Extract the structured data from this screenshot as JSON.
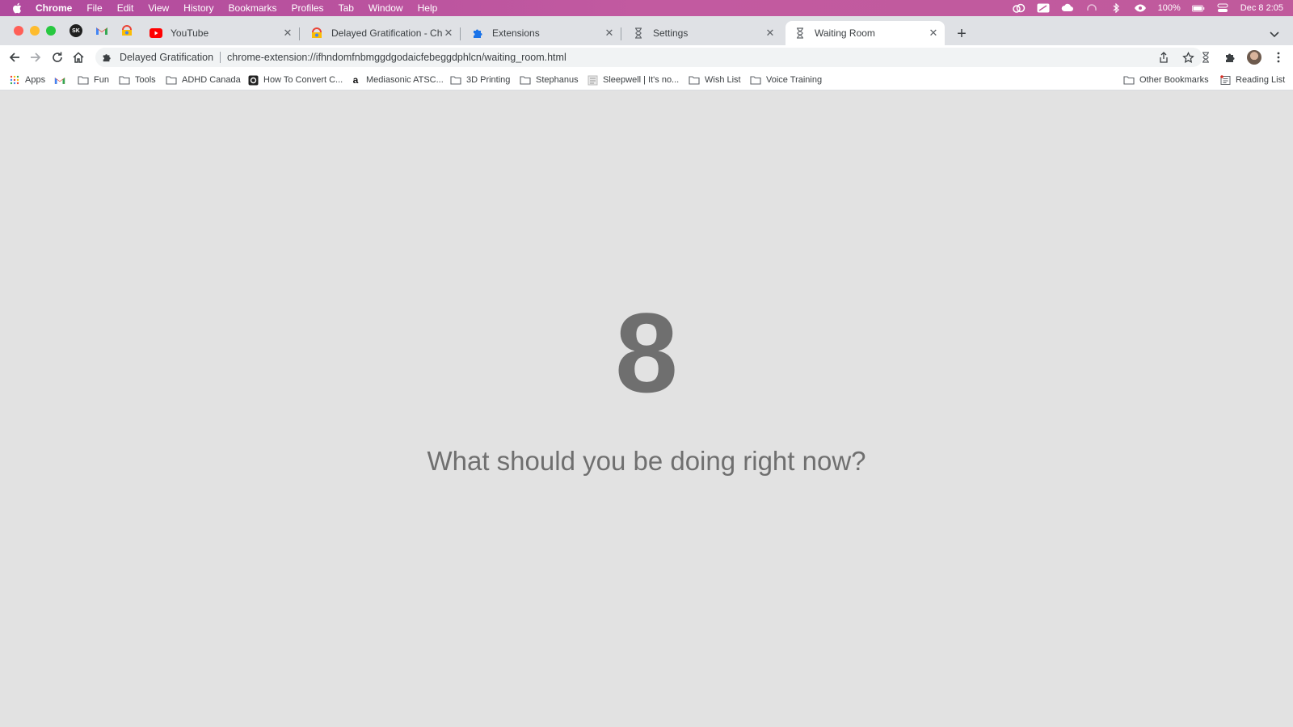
{
  "menubar": {
    "app": "Chrome",
    "items": [
      "File",
      "Edit",
      "View",
      "History",
      "Bookmarks",
      "Profiles",
      "Tab",
      "Window",
      "Help"
    ],
    "battery": "100%",
    "datetime": "Dec 8  2:05"
  },
  "tabs": [
    {
      "title": "YouTube",
      "icon": "youtube-icon"
    },
    {
      "title": "Delayed Gratification - Chrome Web Store",
      "icon": "webstore-icon"
    },
    {
      "title": "Extensions",
      "icon": "puzzle-icon"
    },
    {
      "title": "Settings",
      "icon": "hourglass-icon"
    },
    {
      "title": "Waiting Room",
      "icon": "hourglass-icon",
      "active": true
    }
  ],
  "omnibox": {
    "chip": "Delayed Gratification",
    "url": "chrome-extension://ifhndomfnbmggdgodaicfebeggdphlcn/waiting_room.html"
  },
  "bookmarks": {
    "items": [
      "Apps",
      "Fun",
      "Tools",
      "ADHD Canada",
      "How To Convert C...",
      "Mediasonic ATSC...",
      "3D Printing",
      "Stephanus",
      "Sleepwell | It's no...",
      "Wish List",
      "Voice Training"
    ],
    "other": "Other Bookmarks",
    "reading": "Reading List"
  },
  "page": {
    "countdown": "8",
    "question": "What should you be doing right now?"
  }
}
